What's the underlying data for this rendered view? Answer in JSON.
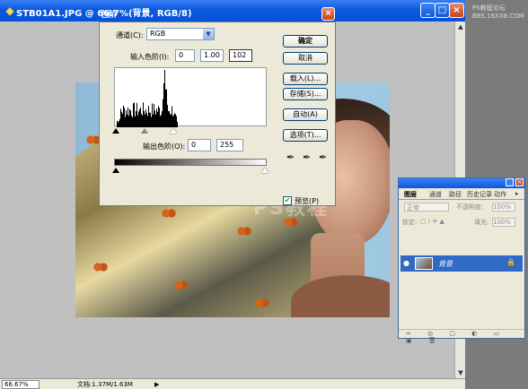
{
  "document": {
    "title": "STB01A1.JPG @ 66.7%(背景, RGB/8)",
    "zoom": "66.67%",
    "doc_size": "文档:1.37M/1.63M"
  },
  "watermark": {
    "line1": "PS教程论坛",
    "line2": "BBS.16XX8.COM"
  },
  "levels_dialog": {
    "title": "色阶",
    "channel_label": "通道(C):",
    "channel_value": "RGB",
    "input_label": "输入色阶(I):",
    "input_black": "0",
    "input_gamma": "1.00",
    "input_white": "102",
    "output_label": "输出色阶(O):",
    "output_black": "0",
    "output_white": "255",
    "buttons": {
      "ok": "确定",
      "cancel": "取消",
      "load": "载入(L)...",
      "save": "存储(S)...",
      "auto": "自动(A)",
      "options": "选项(T)..."
    },
    "preview_label": "预览(P)",
    "preview_checked": true
  },
  "layers_palette": {
    "tabs": [
      "图层",
      "通道",
      "路径",
      "历史记录",
      "动作"
    ],
    "blend_mode": "正常",
    "opacity_label": "不透明度:",
    "opacity_value": "100%",
    "lock_label": "锁定:",
    "fill_label": "填充:",
    "fill_value": "100%",
    "layer_name": "背景"
  }
}
